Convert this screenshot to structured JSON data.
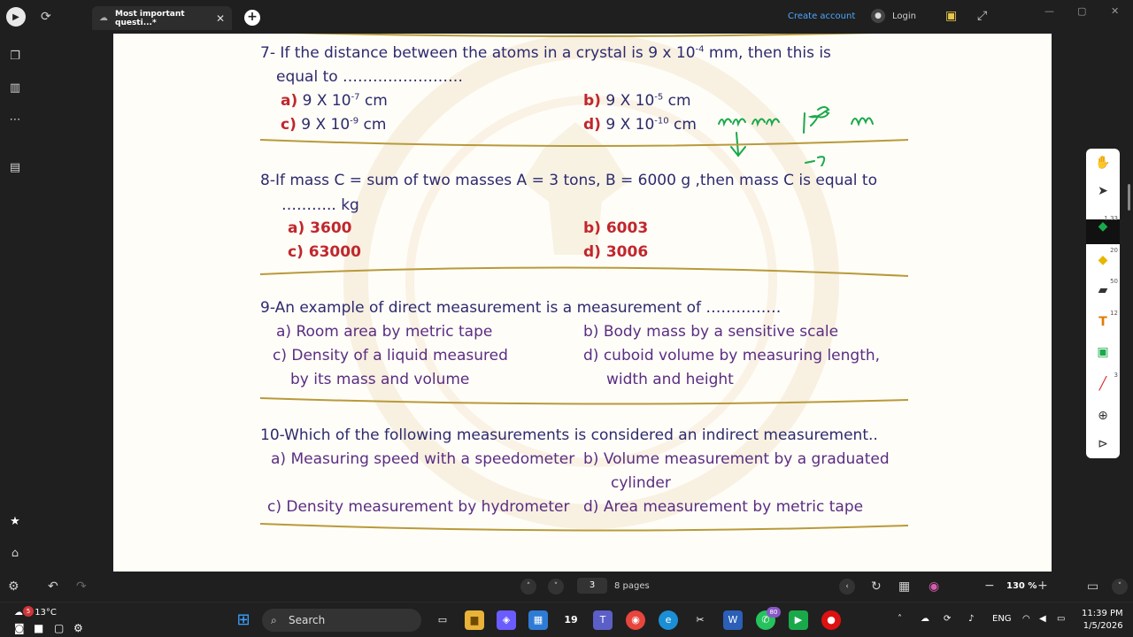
{
  "tab": {
    "title": "Most important questi...*"
  },
  "header": {
    "create_account": "Create account",
    "login": "Login"
  },
  "document": {
    "q7": {
      "line1": "7- If the distance between the atoms in a crystal is 9 x 10",
      "line1_exp": "-4",
      "line1_tail": " mm, then this is",
      "line2": "equal to ……………………",
      "a_label": "a)",
      "a_base": "9 X 10",
      "a_exp": "-7",
      "a_unit": " cm",
      "b_label": "b)",
      "b_base": "9 X 10",
      "b_exp": "-5",
      "b_unit": " cm",
      "c_label": "c)",
      "c_base": "9 X 10",
      "c_exp": "-9",
      "c_unit": " cm",
      "d_label": "d)",
      "d_base": "9 X 10",
      "d_exp": "-10",
      "d_unit": " cm"
    },
    "q8": {
      "line1": "8-If mass C = sum of two masses A = 3 tons, B = 6000 g ,then mass C is  equal to",
      "line2": "……….. kg",
      "a": "a) 3600",
      "b": "b) 6003",
      "c": "c) 63000",
      "d": "d) 3006"
    },
    "q9": {
      "line1": "9-An example of direct measurement is a measurement of ……………",
      "a": "a) Room area by metric tape",
      "b": "b) Body mass by a sensitive scale",
      "c1": "c) Density of a liquid measured",
      "c2": "by its mass and volume",
      "d1": "d) cuboid volume by measuring length,",
      "d2": "width and height"
    },
    "q10": {
      "line1": "10-Which of the following measurements is considered an indirect measurement..",
      "a": "a) Measuring speed with a speedometer",
      "b1": "b) Volume measurement by a graduated",
      "b2": "cylinder",
      "c": "c) Density measurement by hydrometer",
      "d": "d) Area measurement by metric tape"
    }
  },
  "annotations": {
    "color": "#1aa94a"
  },
  "toolbar_right": {
    "pen_size": "1.33",
    "highlighter": "20",
    "eraser": "50",
    "text": "12",
    "line": "3"
  },
  "bottom": {
    "page": "3",
    "pages_label": "8 pages",
    "zoom": "130 %"
  },
  "taskbar": {
    "temperature": "13°C",
    "weather_badge": "5",
    "search": "Search",
    "calendar_day": "19",
    "whatsapp_badge": "80",
    "language": "ENG",
    "time": "11:39 PM",
    "date": "1/5/2026"
  }
}
